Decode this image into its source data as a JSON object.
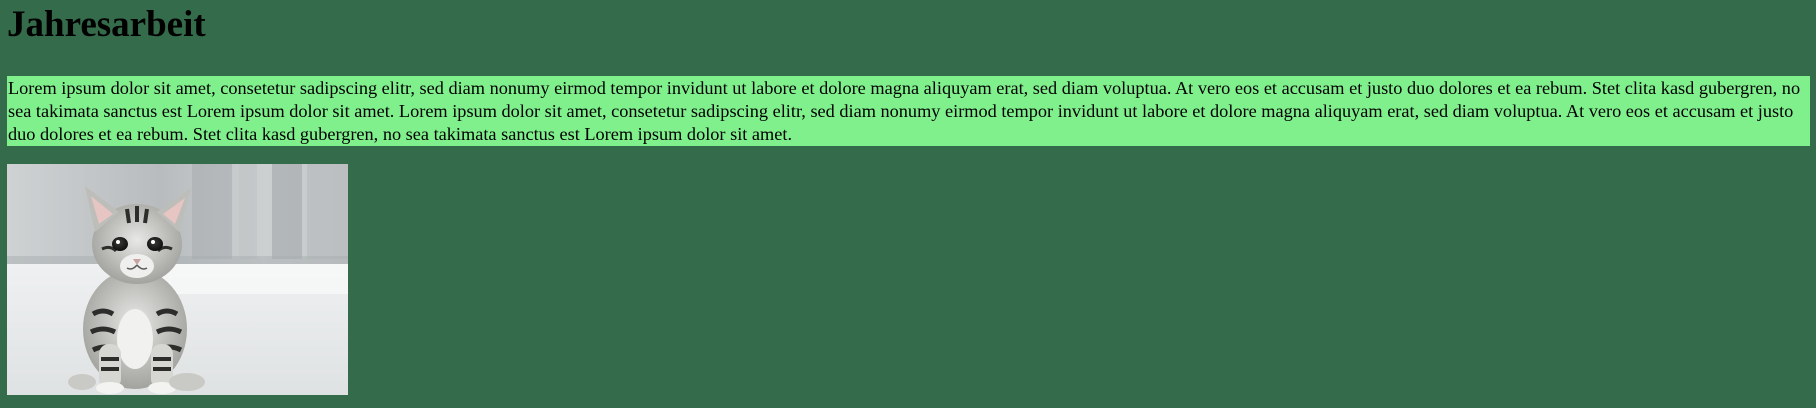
{
  "page": {
    "title": "Jahresarbeit",
    "paragraph": "Lorem ipsum dolor sit amet, consetetur sadipscing elitr, sed diam nonumy eirmod tempor invidunt ut labore et dolore magna aliquyam erat, sed diam voluptua. At vero eos et accusam et justo duo dolores et ea rebum. Stet clita kasd gubergren, no sea takimata sanctus est Lorem ipsum dolor sit amet. Lorem ipsum dolor sit amet, consetetur sadipscing elitr, sed diam nonumy eirmod tempor invidunt ut labore et dolore magna aliquyam erat, sed diam voluptua. At vero eos et accusam et justo duo dolores et ea rebum. Stet clita kasd gubergren, no sea takimata sanctus est Lorem ipsum dolor sit amet."
  },
  "colors": {
    "background": "#346b4b",
    "paragraph_highlight": "#80f08d",
    "text": "#000000"
  },
  "image": {
    "icon": "kitten-photo"
  }
}
